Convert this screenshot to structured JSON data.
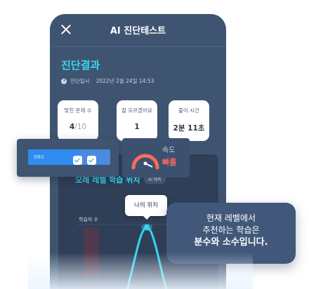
{
  "header": {
    "title": "AI 진단테스트"
  },
  "result": {
    "title": "진단결과",
    "date_label": "진단일시",
    "date_value": "2022년 2월 24일 14:53"
  },
  "stats": [
    {
      "label": "맞힌 문제 수",
      "value": "4",
      "suffix": "/10"
    },
    {
      "label": "잘 모르겠어요",
      "value": "1",
      "suffix": ""
    },
    {
      "label": "풀이 시간",
      "value": "2분 11초",
      "suffix": ""
    }
  ],
  "progress": {
    "label": "정확도",
    "fill_fraction": 0.62,
    "accent": "#2f8cf0"
  },
  "speed": {
    "label": "속도",
    "value": "빠름",
    "color": "#ff6b5a"
  },
  "panel": {
    "section_label": "오레 레벨 학습 위치",
    "ai_badge": "AI 예측",
    "axis_label": "학습자 수",
    "position_label": "나의 위치"
  },
  "tooltip": {
    "lines": [
      "현재 레벨에서",
      "추천하는 학습은",
      "분수와 소수입니다."
    ]
  },
  "colors": {
    "accent": "#35d6ee",
    "phone_bg": "#3f5471",
    "curve": "#35d6ee"
  }
}
